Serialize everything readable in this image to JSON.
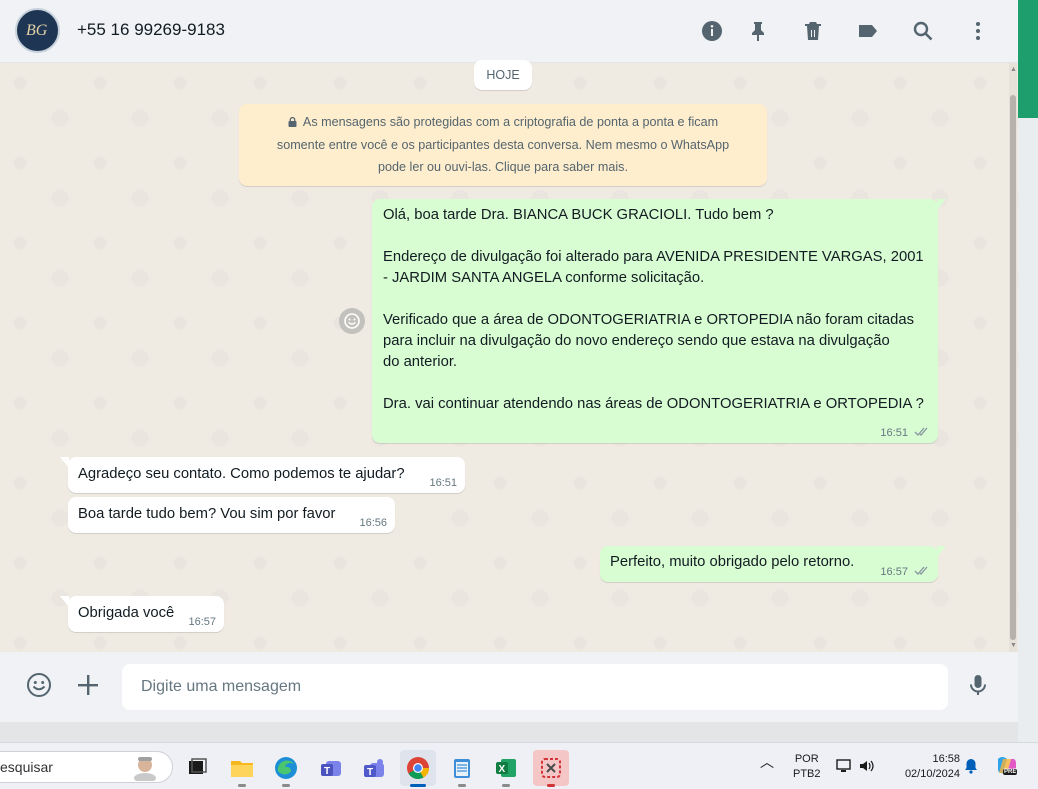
{
  "header": {
    "contact_name": "+55 16 99269-9183",
    "avatar_initials": "BG",
    "icons": [
      "info-icon",
      "pin-icon",
      "delete-icon",
      "label-icon",
      "search-icon",
      "menu-icon"
    ]
  },
  "chat": {
    "day_label": "HOJE",
    "encryption_notice": "As mensagens são protegidas com a criptografia de ponta a ponta e ficam\nsomente entre você e os participantes desta conversa. Nem mesmo o WhatsApp\npode ler ou ouvi-las. Clique para saber mais.",
    "messages": [
      {
        "direction": "out",
        "text": "Olá, boa tarde Dra. BIANCA BUCK GRACIOLI. Tudo bem ?\n\nEndereço de divulgação foi alterado para AVENIDA PRESIDENTE VARGAS, 2001\n- JARDIM SANTA ANGELA conforme solicitação.\n\nVerificado que a área de ODONTOGERIATRIA e ORTOPEDIA não foram citadas\npara incluir na divulgação do novo endereço sendo que estava na divulgação\ndo anterior.\n\nDra. vai continuar atendendo nas áreas de ODONTOGERIATRIA e ORTOPEDIA ?",
        "time": "16:51",
        "status": "read"
      },
      {
        "direction": "in",
        "text": "Agradeço seu contato. Como podemos te ajudar?",
        "time": "16:51"
      },
      {
        "direction": "in",
        "text": "Boa tarde tudo bem? Vou sim por favor",
        "time": "16:56"
      },
      {
        "direction": "out",
        "text": "Perfeito, muito obrigado pelo retorno.",
        "time": "16:57",
        "status": "read"
      },
      {
        "direction": "in",
        "text": "Obrigada você",
        "time": "16:57"
      }
    ]
  },
  "composer": {
    "placeholder": "Digite uma mensagem"
  },
  "taskbar": {
    "search_text": "esquisar",
    "language_line1": "POR",
    "language_line2": "PTB2",
    "clock_time": "16:58",
    "clock_date": "02/10/2024",
    "copilot_badge": "PRE"
  },
  "colors": {
    "outgoing_bubble": "#d9fdd3",
    "incoming_bubble": "#ffffff",
    "encryption_bg": "#ffeecd",
    "accent_green": "#1f9e6d",
    "read_ticks": "#8696a0"
  }
}
